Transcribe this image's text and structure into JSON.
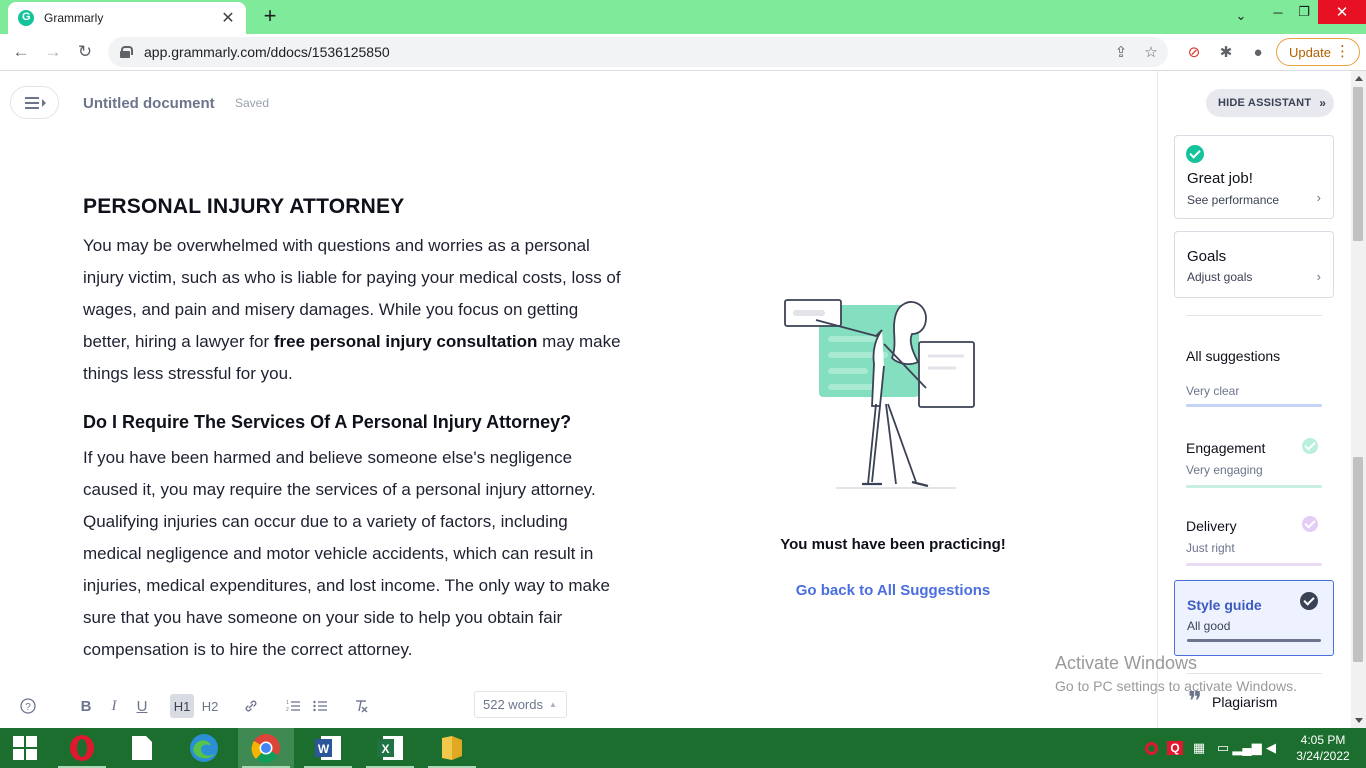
{
  "browser": {
    "tab_title": "Grammarly",
    "url": "app.grammarly.com/ddocs/1536125850",
    "update_label": "Update"
  },
  "doc": {
    "title": "Untitled document",
    "saved": "Saved",
    "h1": "PERSONAL INJURY ATTORNEY",
    "p1_a": "You may be overwhelmed with questions and worries as a personal injury victim, such as who is liable for paying your medical costs, loss of wages, and pain and misery damages. While you focus on getting better, hiring a lawyer for ",
    "p1_bold": "free personal injury consultation",
    "p1_b": " may make things less stressful for you.",
    "h2": "Do I Require The Services Of A Personal Injury Attorney?",
    "p2": "If you have been harmed and believe someone else's negligence caused it, you may require the services of a personal injury attorney. Qualifying injuries can occur due to a variety of factors, including medical negligence and motor vehicle accidents, which can result in injuries, medical expenditures, and lost income. The only way to make sure that you have someone on your side to help you obtain fair compensation is to hire the correct attorney."
  },
  "formatting": {
    "h1": "H1",
    "h2": "H2",
    "bold": "B",
    "italic": "I",
    "underline": "U",
    "word_count": "522 words"
  },
  "center": {
    "praise": "You must have been practicing!",
    "back_link": "Go back to All Suggestions"
  },
  "assistant": {
    "hide_label": "HIDE ASSISTANT",
    "great_title": "Great job!",
    "great_sub": "See performance",
    "goals_title": "Goals",
    "goals_sub": "Adjust goals",
    "all_suggestions": "All suggestions",
    "categories": [
      {
        "title": "",
        "sub": "Very clear",
        "color": "#c5d3f5"
      },
      {
        "title": "Engagement",
        "sub": "Very engaging",
        "color": "#c8efe3"
      },
      {
        "title": "Delivery",
        "sub": "Just right",
        "color": "#eadbf5"
      }
    ],
    "style_guide": {
      "title": "Style guide",
      "sub": "All good"
    },
    "plagiarism": "Plagiarism"
  },
  "watermark": {
    "line1": "Activate Windows",
    "line2": "Go to PC settings to activate Windows."
  },
  "taskbar": {
    "time": "4:05 PM",
    "date": "3/24/2022"
  },
  "colors": {
    "grammarly_green": "#15c39a",
    "link_blue": "#4a6ee0",
    "tab_strip": "#7eea9a",
    "taskbar": "#1b6e2e"
  }
}
